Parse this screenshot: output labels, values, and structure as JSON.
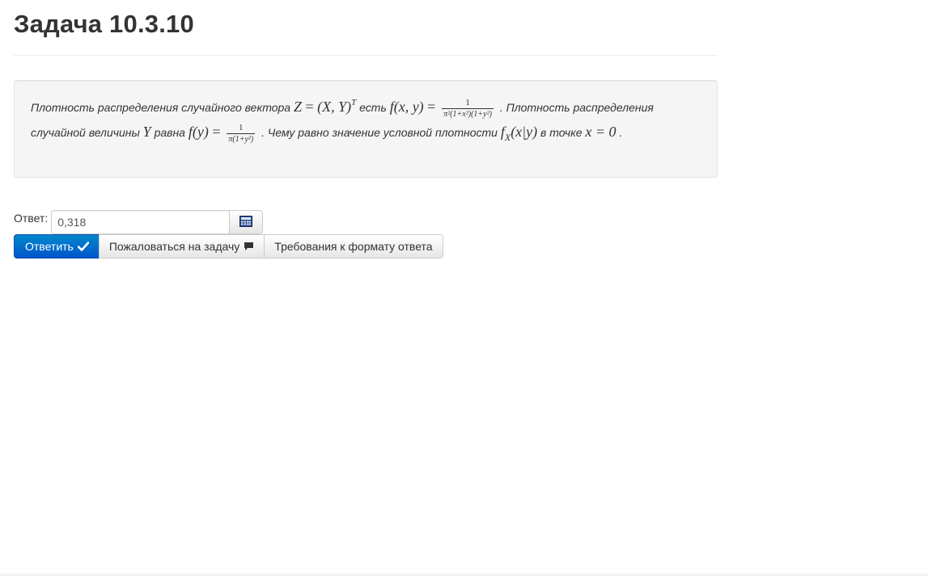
{
  "page": {
    "title": "Задача 10.3.10"
  },
  "problem": {
    "t1": "Плотность распределения случайного вектора",
    "t2": "есть",
    "t3": ". Плотность распределения случайной величины",
    "t4": "равна",
    "t5": ". Чему равно значение условной плотности",
    "t6": "в точке",
    "t7": ".",
    "m_Z": "Z",
    "m_eq": "=",
    "m_XY": "(X, Y)",
    "m_T": "T",
    "m_fxy": "f(x, y)",
    "frac1_num": "1",
    "frac1_den": "π²(1+x²)(1+y²)",
    "m_Y": "Y",
    "m_fy": "f(y)",
    "frac2_num": "1",
    "frac2_den": "π(1+y²)",
    "m_f": "f",
    "m_X": "X",
    "m_xy": "(x|y)",
    "m_x0": "x = 0"
  },
  "answer": {
    "label": "Ответ:",
    "value": "0,318",
    "calculator_icon": "calculator-icon"
  },
  "buttons": {
    "submit_label": "Ответить",
    "submit_icon": "checkmark-icon",
    "complain_label": "Пожаловаться на задачу",
    "complain_icon": "comment-icon",
    "format_label": "Требования к формату ответа"
  },
  "colors": {
    "primary": "#0070cc",
    "well_bg": "#f5f5f5"
  }
}
